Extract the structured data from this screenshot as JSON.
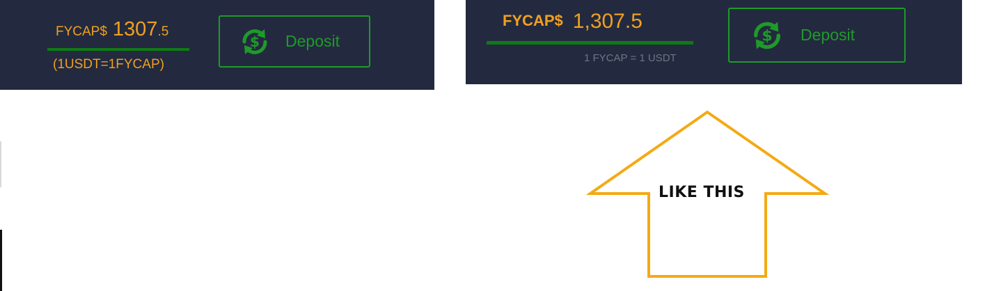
{
  "left_widget": {
    "currency": "FYCAP$",
    "amount_main": "1307",
    "amount_decimal": ".5",
    "rate": "(1USDT=1FYCAP)",
    "deposit_label": "Deposit"
  },
  "right_widget": {
    "currency": "FYCAP$",
    "amount": "1,307.5",
    "rate": "1 FYCAP = 1 USDT",
    "deposit_label": "Deposit"
  },
  "annotation": {
    "label": "LIKE THIS"
  },
  "icons": {
    "deposit": "dollar-exchange-icon"
  },
  "colors": {
    "panel_bg": "#232a3f",
    "accent_orange": "#f0a020",
    "accent_green": "#1f9a2a",
    "rule_green": "#0f7a15",
    "rate_gray": "#6e7485",
    "arrow_orange": "#f4aa14"
  }
}
